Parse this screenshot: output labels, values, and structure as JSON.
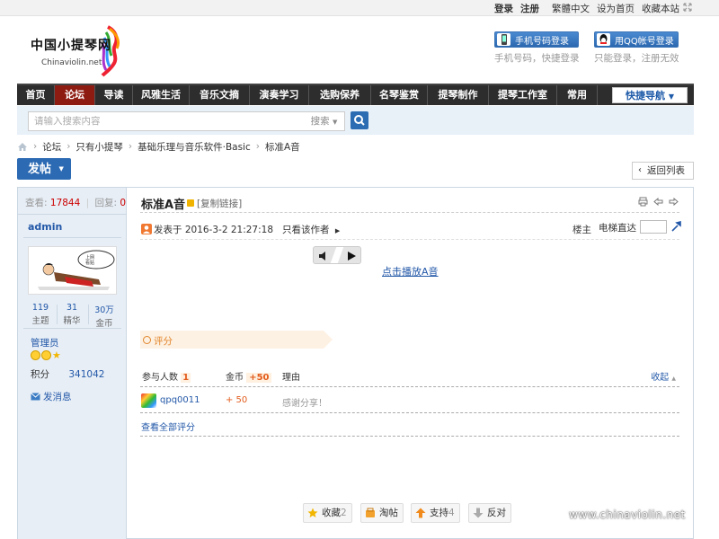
{
  "topbar": {
    "login": "登录",
    "register": "注册",
    "traditional": "繁體中文",
    "set_home": "设为首页",
    "bookmark": "收藏本站"
  },
  "header": {
    "logo_cn": "中国小提琴网",
    "logo_en": "Chinaviolin.net",
    "phone_login": "手机号码登录",
    "phone_note": "手机号码，快捷登录",
    "qq_login": "用QQ帐号登录",
    "qq_note": "只能登录，注册无效"
  },
  "nav": {
    "items": [
      "首页",
      "论坛",
      "导读",
      "风雅生活",
      "音乐文摘",
      "演奏学习",
      "选购保养",
      "名琴鉴赏",
      "提琴制作",
      "提琴工作室",
      "常用"
    ],
    "active": "论坛",
    "quick_nav": "快捷导航"
  },
  "search": {
    "placeholder": "请输入搜索内容",
    "scope": "搜索"
  },
  "breadcrumb": [
    "论坛",
    "只有小提琴",
    "基础乐理与音乐软件·Basic",
    "标准A音"
  ],
  "actions": {
    "post": "发帖",
    "back_to_list": "返回列表"
  },
  "sidebar": {
    "views_label": "查看:",
    "views": "17844",
    "replies_label": "回复:",
    "replies": "0",
    "author": "admin",
    "counts": [
      {
        "value": "119",
        "label": "主题"
      },
      {
        "value": "31",
        "label": "精华"
      },
      {
        "value": "30万",
        "label": "金币"
      }
    ],
    "user_group": "管理员",
    "points_label": "积分",
    "points": "341042",
    "send_message": "发消息"
  },
  "post": {
    "title": "标准A音",
    "copy_link": "[复制链接]",
    "posted_at": "发表于 2016-3-2 21:27:18",
    "only_author": "只看该作者",
    "floor": "楼主",
    "elevator": "电梯直达",
    "play_link": "点击播放A音"
  },
  "rating": {
    "header": "评分",
    "participants_label": "参与人数",
    "participants": "1",
    "coins_label": "金币",
    "coins_total": "+50",
    "reason_label": "理由",
    "collapse": "收起",
    "rows": [
      {
        "user": "qpq0011",
        "coins": "+ 50",
        "reason": "感谢分享！"
      }
    ],
    "view_all": "查看全部评分"
  },
  "post_actions": {
    "favorite": "收藏",
    "favorite_count": "2",
    "tao": "淘帖",
    "support": "支持",
    "support_count": "4",
    "oppose": "反对"
  },
  "watermark": "www.chinaviolin.net",
  "colors": {
    "nav_bg": "#2d2d2d",
    "nav_active": "#8e1b12",
    "link_blue": "#2358a8",
    "accent_orange": "#e2852a",
    "sidebar_bg": "#e7eef6"
  }
}
